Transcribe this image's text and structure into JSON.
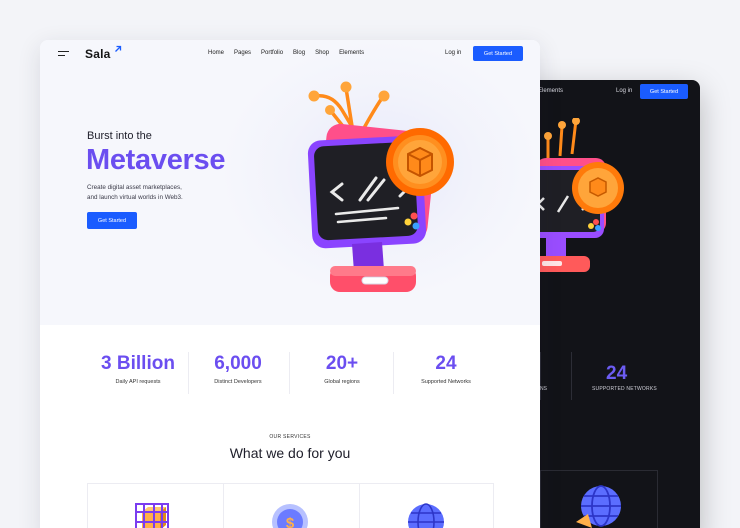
{
  "nav": {
    "logo": "Sala",
    "links": [
      "Home",
      "Pages",
      "Portfolio",
      "Blog",
      "Shop",
      "Elements"
    ],
    "login": "Log in",
    "cta": "Get Started"
  },
  "hero": {
    "kicker": "Burst into the",
    "headline": "Metaverse",
    "subtext_line1": "Create digital asset marketplaces,",
    "subtext_line2": "and launch virtual worlds in Web3.",
    "cta": "Get Started"
  },
  "stats": [
    {
      "value": "3 Billion",
      "label": "Daily API requests"
    },
    {
      "value": "6,000",
      "label": "Distinct Developers"
    },
    {
      "value": "20+",
      "label": "Global regions"
    },
    {
      "value": "24",
      "label": "Supported Networks"
    }
  ],
  "services": {
    "kicker": "OUR SERVICES",
    "title": "What we do for you",
    "icons": [
      "cube-cage-icon",
      "coin-icon",
      "globe-icon"
    ]
  },
  "dark_preview": {
    "nav_link": "Elements",
    "login": "Log in",
    "cta": "Get Started",
    "stat_value": "24",
    "stat_label": "SUPPORTED NETWORKS",
    "stat_cut_label": "NS"
  },
  "colors": {
    "accent_purple": "#6b4ef0",
    "button_blue": "#1a5cff",
    "dark_bg": "#121318"
  }
}
